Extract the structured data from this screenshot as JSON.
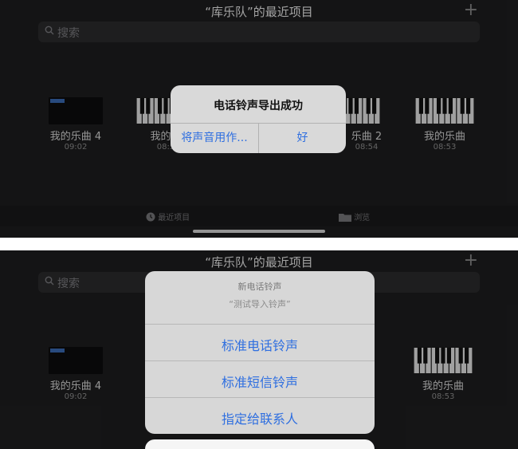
{
  "top": {
    "title": "“库乐队”的最近项目",
    "plus": "+",
    "search_placeholder": "搜索",
    "projects": [
      {
        "name": "我的乐曲 4",
        "time": "09:02",
        "thumb": "dark"
      },
      {
        "name": "我的乐",
        "time": "08:5",
        "thumb": "piano"
      },
      {
        "name": "乐曲 2",
        "time": "08:54",
        "thumb": "piano"
      },
      {
        "name": "我的乐曲",
        "time": "08:53",
        "thumb": "piano"
      }
    ],
    "tabs": {
      "recent": "最近项目",
      "browse": "浏览"
    },
    "alert": {
      "title": "电话铃声导出成功",
      "left_button": "将声音用作...",
      "right_button": "好"
    }
  },
  "bottom": {
    "title": "“库乐队”的最近项目",
    "plus": "+",
    "search_placeholder": "搜索",
    "projects": [
      {
        "name": "我的乐曲 4",
        "time": "09:02",
        "thumb": "dark"
      },
      {
        "name": "我的乐曲",
        "time": "08:53",
        "thumb": "piano"
      }
    ],
    "sheet": {
      "header": "新电话铃声",
      "subheader": "“测试导入铃声”",
      "options": [
        "标准电话铃声",
        "标准短信铃声",
        "指定给联系人"
      ]
    }
  },
  "colors": {
    "accent": "#2f6fe0",
    "background": "#1e1e1f"
  }
}
